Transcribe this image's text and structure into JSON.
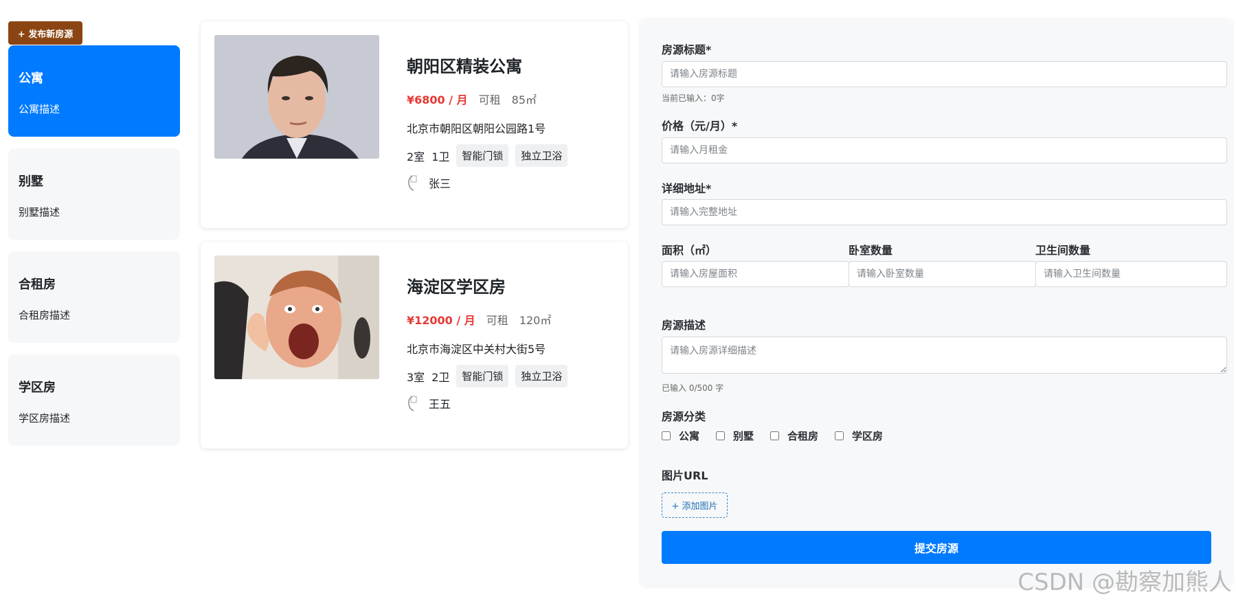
{
  "sidebar": {
    "publish_label": "+ 发布新房源",
    "categories": [
      {
        "title": "公寓",
        "desc": "公寓描述"
      },
      {
        "title": "别墅",
        "desc": "别墅描述"
      },
      {
        "title": "合租房",
        "desc": "合租房描述"
      },
      {
        "title": "学区房",
        "desc": "学区房描述"
      }
    ]
  },
  "listings": [
    {
      "title": "朝阳区精装公寓",
      "price": "¥6800 / 月",
      "status": "可租",
      "area": "85㎡",
      "address": "北京市朝阳区朝阳公园路1号",
      "rooms": "2室",
      "baths": "1卫",
      "tags": [
        "智能门锁",
        "独立卫浴"
      ],
      "owner": "张三"
    },
    {
      "title": "海淀区学区房",
      "price": "¥12000 / 月",
      "status": "可租",
      "area": "120㎡",
      "address": "北京市海淀区中关村大街5号",
      "rooms": "3室",
      "baths": "2卫",
      "tags": [
        "智能门锁",
        "独立卫浴"
      ],
      "owner": "王五"
    }
  ],
  "form": {
    "title_label": "房源标题*",
    "title_placeholder": "请输入房源标题",
    "title_count": "当前已输入：0字",
    "price_label": "价格（元/月）*",
    "price_placeholder": "请输入月租金",
    "address_label": "详细地址*",
    "address_placeholder": "请输入完整地址",
    "area_label": "面积（㎡）",
    "area_placeholder": "请输入房屋面积",
    "bedroom_label": "卧室数量",
    "bedroom_placeholder": "请输入卧室数量",
    "bathroom_label": "卫生间数量",
    "bathroom_placeholder": "请输入卫生间数量",
    "desc_label": "房源描述",
    "desc_placeholder": "请输入房源详细描述",
    "desc_count": "已输入 0/500 字",
    "category_label": "房源分类",
    "categories": [
      "公寓",
      "别墅",
      "合租房",
      "学区房"
    ],
    "image_label": "图片URL",
    "add_image_label": "+ 添加图片",
    "submit_label": "提交房源"
  },
  "watermark": "CSDN @勘察加熊人",
  "colors": {
    "primary": "#007bff",
    "publish": "#8b4513",
    "price": "#e53935"
  }
}
